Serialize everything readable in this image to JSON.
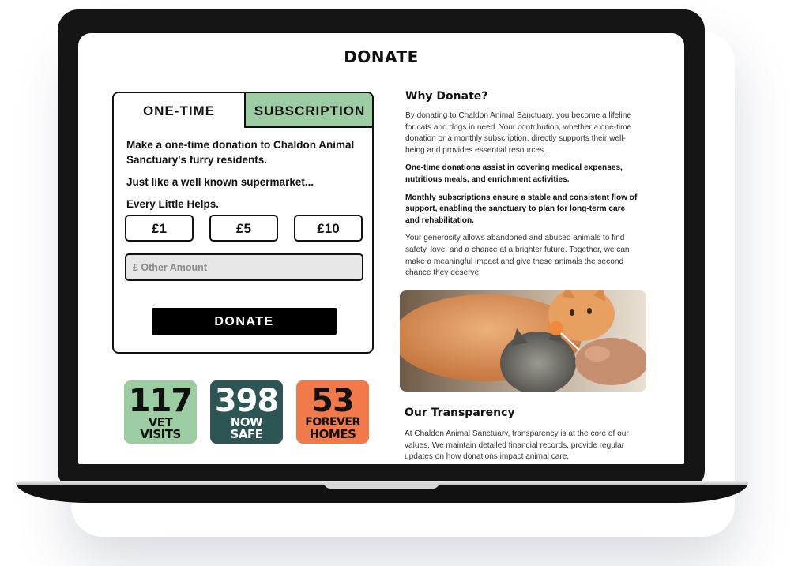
{
  "page": {
    "title": "DONATE"
  },
  "tabs": [
    {
      "label": "ONE-TIME",
      "active": true
    },
    {
      "label": "SUBSCRIPTION",
      "active": false
    }
  ],
  "card": {
    "intro": "Make a one-time donation to Chaldon Animal Sanctuary's furry residents.",
    "line2": "Just like a well known supermarket...",
    "line3": "Every Little Helps.",
    "amounts": [
      "£1",
      "£5",
      "£10"
    ],
    "other_placeholder": "£ Other Amount",
    "donate_label": "DONATE"
  },
  "stats": [
    {
      "number": "117",
      "label_1": "VET",
      "label_2": "VISITS",
      "bg": "#9ccca1",
      "fg": "#111111"
    },
    {
      "number": "398",
      "label_1": "NOW",
      "label_2": "SAFE",
      "bg": "#2c5553",
      "fg": "#ffffff"
    },
    {
      "number": "53",
      "label_1": "FOREVER",
      "label_2": "HOMES",
      "bg": "#f27a4a",
      "fg": "#111111"
    }
  ],
  "why": {
    "heading": "Why Donate?",
    "para1": "By donating to Chaldon Animal Sanctuary, you become a lifeline for cats and dogs in need. Your contribution, whether a one-time donation or a monthly subscription, directly supports their well-being and provides essential resources.",
    "para2": "One-time donations assist in covering medical expenses, nutritious meals, and enrichment activities.",
    "para3": "Monthly subscriptions ensure a stable and consistent flow of support, enabling the sanctuary to plan for long-term care and rehabilitation.",
    "para4": "Your generosity allows abandoned and abused animals to find safety, love, and a chance at a brighter future. Together, we can make a meaningful impact and give these animals the second chance they deserve."
  },
  "transparency": {
    "heading": "Our Transparency",
    "para": "At Chaldon Animal Sanctuary, transparency is at the core of our values. We maintain detailed financial records, provide regular updates on how donations impact animal care,"
  },
  "colors": {
    "tab_active_bg": "#9ccca1",
    "button_bg": "#000000",
    "input_bg": "#e6e6e6"
  }
}
